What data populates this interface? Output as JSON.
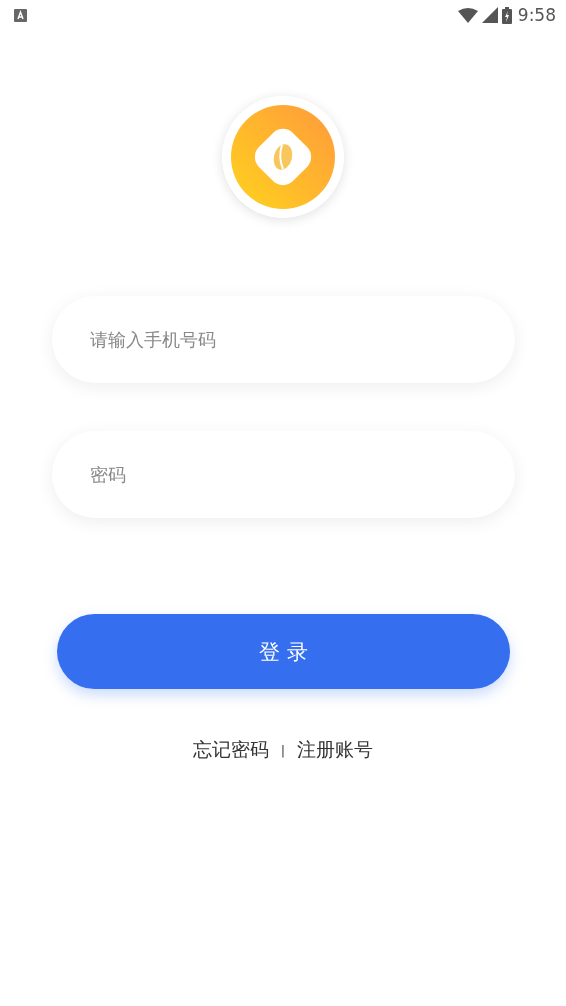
{
  "status_bar": {
    "time": "9:58"
  },
  "form": {
    "phone": {
      "placeholder": "请输入手机号码"
    },
    "password": {
      "placeholder": "密码"
    }
  },
  "login_button": "登 录",
  "links": {
    "forgot": "忘记密码",
    "separator": "|",
    "register": "注册账号"
  }
}
